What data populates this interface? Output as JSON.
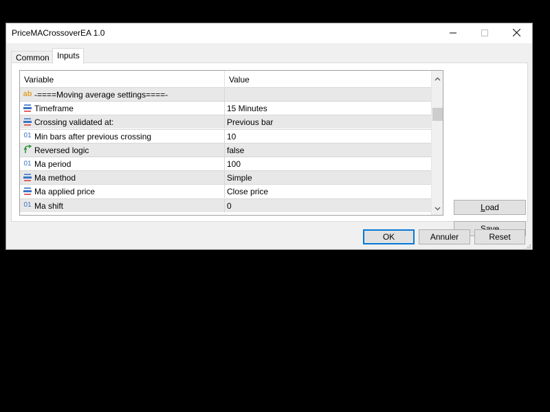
{
  "window": {
    "title": "PriceMACrossoverEA 1.0",
    "controls": {
      "minimize": "minimize-icon",
      "maximize": "maximize-icon",
      "close": "close-icon"
    }
  },
  "tabs": [
    {
      "label": "Common",
      "active": false
    },
    {
      "label": "Inputs",
      "active": true
    }
  ],
  "grid": {
    "columns": {
      "variable": "Variable",
      "value": "Value"
    },
    "rows": [
      {
        "icon": "string-icon",
        "name": "-====Moving average settings====-",
        "value": ""
      },
      {
        "icon": "enum-icon",
        "name": "Timeframe",
        "value": "15 Minutes"
      },
      {
        "icon": "enum-icon",
        "name": "Crossing validated at:",
        "value": "Previous bar"
      },
      {
        "icon": "integer-icon",
        "name": "Min bars after previous crossing",
        "value": "10"
      },
      {
        "icon": "boolean-icon",
        "name": "Reversed logic",
        "value": "false"
      },
      {
        "icon": "integer-icon",
        "name": "Ma period",
        "value": "100"
      },
      {
        "icon": "enum-icon",
        "name": "Ma method",
        "value": "Simple"
      },
      {
        "icon": "enum-icon",
        "name": "Ma applied price",
        "value": "Close price"
      },
      {
        "icon": "integer-icon",
        "name": "Ma shift",
        "value": "0"
      }
    ]
  },
  "side_buttons": {
    "load": {
      "accel": "L",
      "rest": "oad"
    },
    "save": {
      "accel": "S",
      "rest": "ave"
    }
  },
  "footer": {
    "ok": "OK",
    "cancel": "Annuler",
    "reset": "Reset"
  },
  "colors": {
    "accent": "#0078d7",
    "button_bg": "#e1e1e1",
    "dialog_bg": "#f0f0f0"
  }
}
